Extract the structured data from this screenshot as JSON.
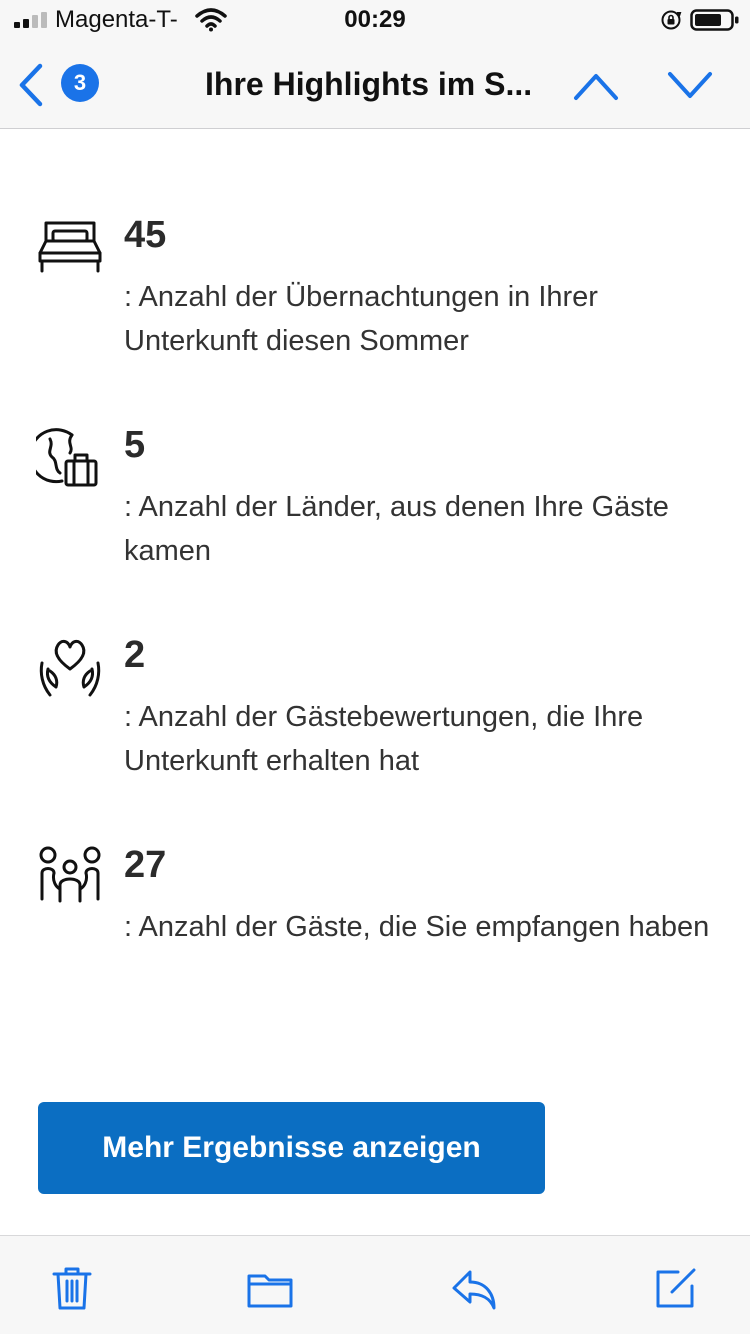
{
  "status_bar": {
    "carrier": "Magenta-T-",
    "time": "00:29"
  },
  "nav": {
    "unread_count": "3",
    "title": "Ihre Highlights im S..."
  },
  "stats": [
    {
      "icon": "bed-icon",
      "value": "45",
      "description": ": Anzahl der Übernachtungen in Ihrer Unterkunft diesen Sommer"
    },
    {
      "icon": "globe-luggage-icon",
      "value": "5",
      "description": ": Anzahl der Länder, aus denen Ihre Gäste kamen"
    },
    {
      "icon": "heart-hands-icon",
      "value": "2",
      "description": ": Anzahl der Gästebewertungen, die Ihre Unterkunft erhalten hat"
    },
    {
      "icon": "family-icon",
      "value": "27",
      "description": ": Anzahl der Gäste, die Sie empfangen haben"
    }
  ],
  "button": {
    "label": "Mehr Ergebnisse anzeigen"
  },
  "colors": {
    "ios_blue": "#1a73e8",
    "button_blue": "#0b6ec2",
    "bar_background": "#f7f7f7"
  }
}
